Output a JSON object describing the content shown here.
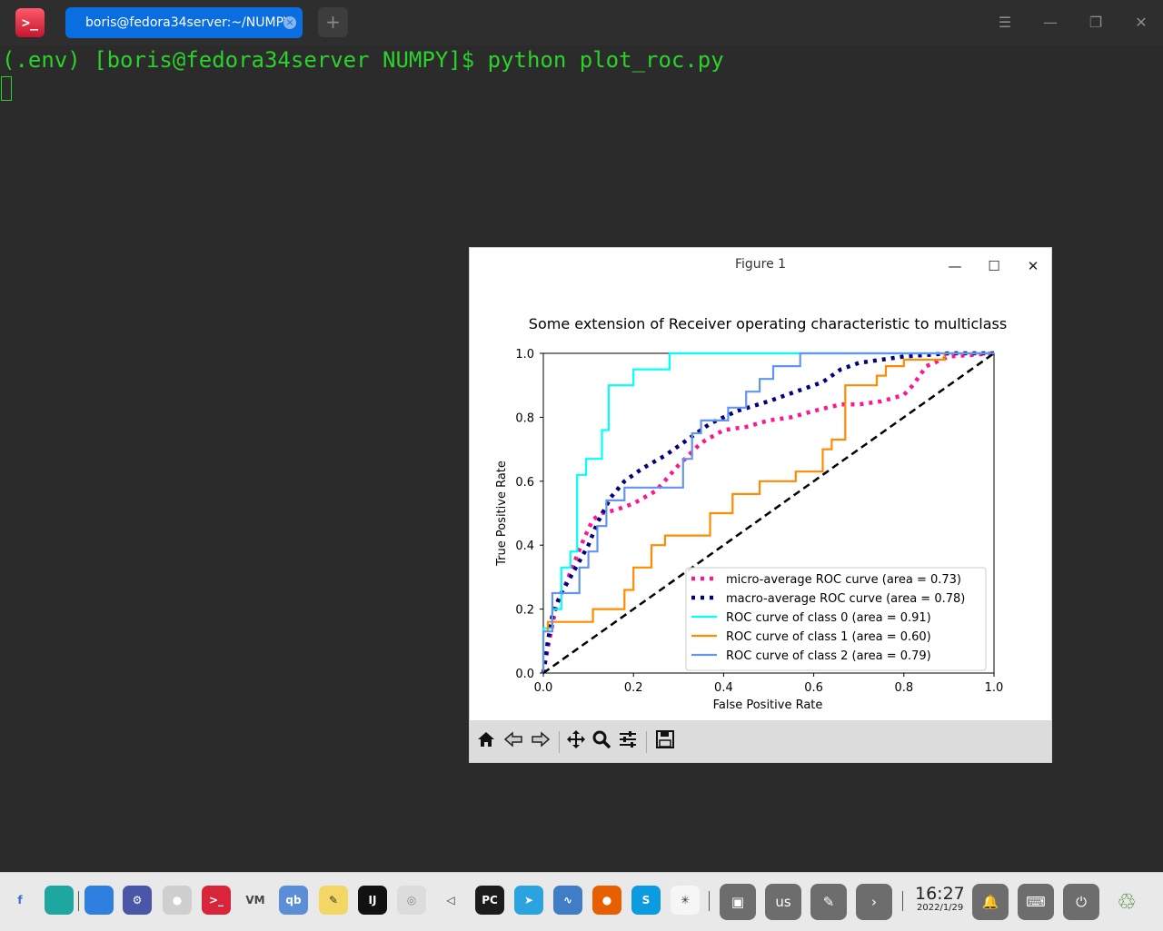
{
  "topbar": {
    "app_icon_label": ">_",
    "tab_title": "boris@fedora34server:~/NUMPY",
    "tab_close": "×",
    "new_tab": "+",
    "menu": "☰",
    "minimize": "—",
    "restore": "❐",
    "close": "✕"
  },
  "terminal": {
    "prompt_line": "(.env) [boris@fedora34server NUMPY]$ python plot_roc.py",
    "text_color": "#2bd22b"
  },
  "figure_window": {
    "title": "Figure 1",
    "minimize": "—",
    "maximize": "☐",
    "close": "✕",
    "toolbar": {
      "home": "home-icon",
      "back": "back-arrow-icon",
      "forward": "forward-arrow-icon",
      "pan": "move-icon",
      "zoom": "magnifier-icon",
      "configure": "sliders-icon",
      "save": "floppy-icon"
    }
  },
  "chart_data": {
    "type": "line",
    "title": "Some extension of Receiver operating characteristic to multiclass",
    "xlabel": "False Positive Rate",
    "ylabel": "True Positive Rate",
    "xlim": [
      0.0,
      1.0
    ],
    "ylim": [
      0.0,
      1.0
    ],
    "xticks": [
      "0.0",
      "0.2",
      "0.4",
      "0.6",
      "0.8",
      "1.0"
    ],
    "yticks": [
      "0.0",
      "0.2",
      "0.4",
      "0.6",
      "0.8",
      "1.0"
    ],
    "legend_position": "lower right",
    "series": [
      {
        "name": "micro-average ROC curve (area = 0.73)",
        "color": "#ff1493",
        "style": "dotted",
        "x": [
          0,
          0.01,
          0.02,
          0.03,
          0.05,
          0.07,
          0.09,
          0.11,
          0.13,
          0.16,
          0.2,
          0.25,
          0.3,
          0.35,
          0.4,
          0.45,
          0.5,
          0.55,
          0.6,
          0.63,
          0.66,
          0.7,
          0.75,
          0.8,
          0.82,
          0.85,
          0.9,
          1.0
        ],
        "y": [
          0,
          0.08,
          0.15,
          0.22,
          0.28,
          0.35,
          0.42,
          0.48,
          0.5,
          0.51,
          0.53,
          0.57,
          0.65,
          0.72,
          0.76,
          0.77,
          0.79,
          0.8,
          0.82,
          0.83,
          0.84,
          0.84,
          0.85,
          0.87,
          0.9,
          0.96,
          0.99,
          1.0
        ]
      },
      {
        "name": "macro-average ROC curve (area = 0.78)",
        "color": "#000080",
        "style": "dotted",
        "x": [
          0,
          0.01,
          0.02,
          0.04,
          0.06,
          0.08,
          0.1,
          0.12,
          0.15,
          0.18,
          0.22,
          0.27,
          0.32,
          0.37,
          0.43,
          0.5,
          0.56,
          0.62,
          0.66,
          0.7,
          0.75,
          0.8,
          0.85,
          0.9,
          1.0
        ],
        "y": [
          0,
          0.1,
          0.18,
          0.25,
          0.3,
          0.35,
          0.4,
          0.47,
          0.55,
          0.6,
          0.64,
          0.68,
          0.73,
          0.78,
          0.82,
          0.85,
          0.88,
          0.91,
          0.95,
          0.97,
          0.98,
          0.99,
          0.995,
          1.0,
          1.0
        ]
      },
      {
        "name": "ROC curve of class 0 (area = 0.91)",
        "color": "#00ffff",
        "style": "step",
        "x": [
          0,
          0,
          0.02,
          0.02,
          0.04,
          0.04,
          0.06,
          0.06,
          0.075,
          0.075,
          0.095,
          0.095,
          0.13,
          0.13,
          0.145,
          0.145,
          0.2,
          0.2,
          0.28,
          0.28,
          1.0
        ],
        "y": [
          0,
          0.14,
          0.14,
          0.2,
          0.2,
          0.33,
          0.33,
          0.38,
          0.38,
          0.62,
          0.62,
          0.67,
          0.67,
          0.76,
          0.76,
          0.9,
          0.9,
          0.95,
          0.95,
          1.0,
          1.0
        ]
      },
      {
        "name": "ROC curve of class 1 (area = 0.60)",
        "color": "#ff8c00",
        "style": "step",
        "x": [
          0,
          0,
          0.01,
          0.01,
          0.11,
          0.11,
          0.18,
          0.18,
          0.2,
          0.2,
          0.24,
          0.24,
          0.27,
          0.27,
          0.37,
          0.37,
          0.42,
          0.42,
          0.48,
          0.48,
          0.56,
          0.56,
          0.62,
          0.62,
          0.64,
          0.64,
          0.67,
          0.67,
          0.74,
          0.74,
          0.76,
          0.76,
          0.8,
          0.8,
          0.89,
          0.89,
          1.0
        ],
        "y": [
          0,
          0.13,
          0.13,
          0.16,
          0.16,
          0.2,
          0.2,
          0.26,
          0.26,
          0.33,
          0.33,
          0.4,
          0.4,
          0.43,
          0.43,
          0.5,
          0.5,
          0.56,
          0.56,
          0.6,
          0.6,
          0.63,
          0.63,
          0.7,
          0.7,
          0.73,
          0.73,
          0.9,
          0.9,
          0.93,
          0.93,
          0.96,
          0.96,
          0.98,
          0.98,
          1.0,
          1.0
        ]
      },
      {
        "name": "ROC curve of class 2 (area = 0.79)",
        "color": "#6495ed",
        "style": "step",
        "x": [
          0,
          0,
          0.02,
          0.02,
          0.08,
          0.08,
          0.1,
          0.1,
          0.12,
          0.12,
          0.14,
          0.14,
          0.18,
          0.18,
          0.31,
          0.31,
          0.33,
          0.33,
          0.35,
          0.35,
          0.41,
          0.41,
          0.45,
          0.45,
          0.48,
          0.48,
          0.51,
          0.51,
          0.57,
          0.57,
          1.0
        ],
        "y": [
          0,
          0.13,
          0.13,
          0.25,
          0.25,
          0.33,
          0.33,
          0.38,
          0.38,
          0.46,
          0.46,
          0.54,
          0.54,
          0.58,
          0.58,
          0.67,
          0.67,
          0.75,
          0.75,
          0.79,
          0.79,
          0.83,
          0.83,
          0.88,
          0.88,
          0.92,
          0.92,
          0.96,
          0.96,
          1.0,
          1.0
        ]
      },
      {
        "name": "",
        "color": "#000000",
        "style": "dashed",
        "x": [
          0,
          1
        ],
        "y": [
          0,
          1
        ]
      }
    ]
  },
  "taskbar": {
    "dock": [
      {
        "name": "fedora-icon",
        "label": "f",
        "color": "#3b6ecf",
        "bg": "transparent"
      },
      {
        "name": "files-icon",
        "label": "",
        "color": "#ffffff",
        "bg": "#1ea7a1"
      },
      {
        "name": "store-icon",
        "label": "",
        "color": "#ffffff",
        "bg": "#2f7fe0"
      },
      {
        "name": "settings-icon",
        "label": "⚙",
        "color": "#ffffff",
        "bg": "#4a57a8"
      },
      {
        "name": "chrome-icon",
        "label": "●",
        "color": "#ffffff",
        "bg": "#cfcfcf"
      },
      {
        "name": "terminal-icon",
        "label": ">_",
        "color": "#ffffff",
        "bg": "#d8253a"
      },
      {
        "name": "vim-icon",
        "label": "VM",
        "color": "#444444",
        "bg": "transparent"
      },
      {
        "name": "qbittorrent-icon",
        "label": "qb",
        "color": "#ffffff",
        "bg": "#5a8fd8"
      },
      {
        "name": "text-editor-icon",
        "label": "✎",
        "color": "#333333",
        "bg": "#f3d663"
      },
      {
        "name": "intellij-icon",
        "label": "IJ",
        "color": "#ffffff",
        "bg": "#111111"
      },
      {
        "name": "disc-icon",
        "label": "◎",
        "color": "#888888",
        "bg": "#dcdcdc"
      },
      {
        "name": "volume-icon",
        "label": "◁",
        "color": "#333333",
        "bg": "transparent"
      },
      {
        "name": "pycharm-icon",
        "label": "PC",
        "color": "#ffffff",
        "bg": "#1c1c1c"
      },
      {
        "name": "telegram-icon",
        "label": "➤",
        "color": "#ffffff",
        "bg": "#2aa3df"
      },
      {
        "name": "system-monitor-icon",
        "label": "∿",
        "color": "#ffffff",
        "bg": "#3f7ec6"
      },
      {
        "name": "firefox-icon",
        "label": "●",
        "color": "#ffffff",
        "bg": "#e66000"
      },
      {
        "name": "skype-icon",
        "label": "S",
        "color": "#ffffff",
        "bg": "#0c9ae0"
      },
      {
        "name": "matplotlib-icon",
        "label": "✳",
        "color": "#333333",
        "bg": "#f6f6f6"
      }
    ],
    "tray": {
      "box_icon": "▣",
      "keyboard_layout": "us",
      "pen_icon": "✎",
      "expand_icon": "›",
      "time": "16:27",
      "date": "2022/1/29",
      "bell_icon": "🔔",
      "keyboard_icon": "⌨",
      "power_icon": "⏻",
      "trash_icon": "♲"
    }
  }
}
